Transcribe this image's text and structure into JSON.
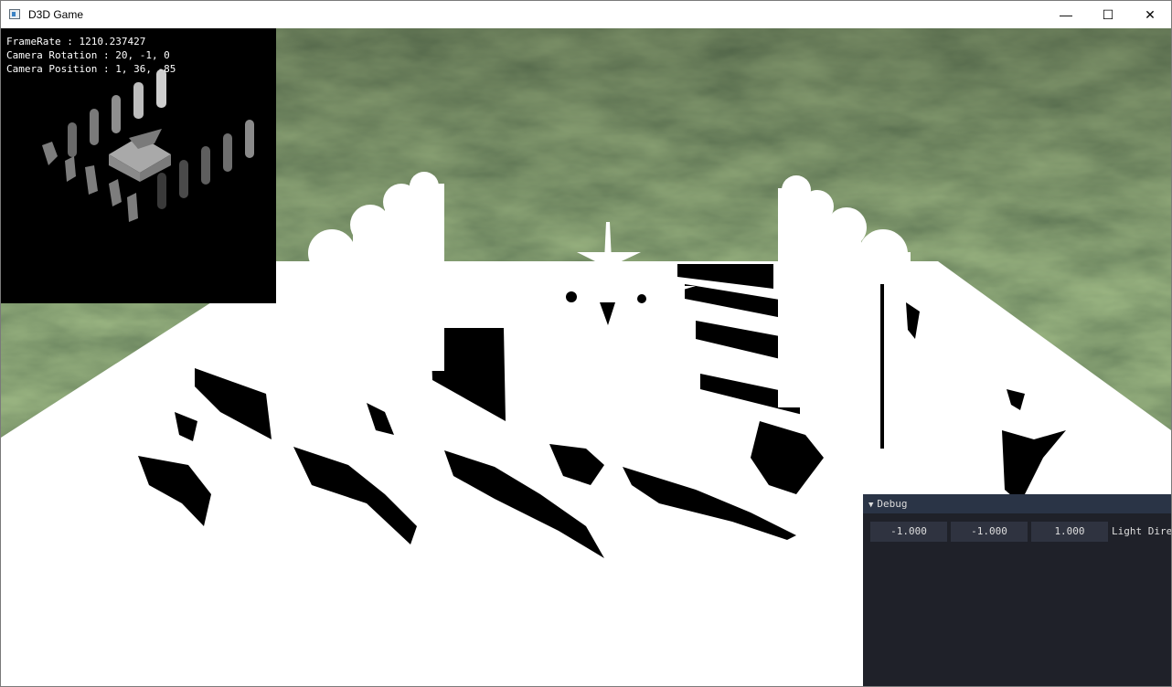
{
  "window": {
    "title": "D3D Game",
    "controls": {
      "minimize": "—",
      "maximize": "☐",
      "close": "✕"
    }
  },
  "stats": {
    "framerate": "FrameRate : 1210.237427",
    "camera_rotation": "Camera Rotation : 20, -1, 0",
    "camera_position": "Camera Position : 1, 36, -85"
  },
  "debug": {
    "title": "Debug",
    "light_dir": {
      "x": "-1.000",
      "y": "-1.000",
      "z": "1.000",
      "label": "Light Direction"
    }
  },
  "colors": {
    "terrain": "#3f5a33",
    "floor": "#ffffff",
    "shadow": "#000000",
    "panel_bg": "#1f2129",
    "panel_header": "#2a3446",
    "field_bg": "#2f3340"
  }
}
